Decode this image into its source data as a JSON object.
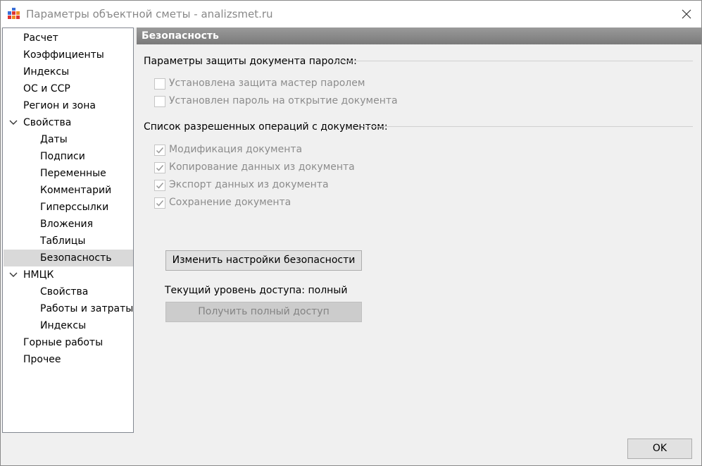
{
  "window": {
    "title": "Параметры объектной сметы - analizsmet.ru",
    "icon": "app-grid-icon",
    "close_icon": "close-icon"
  },
  "tree": {
    "items": [
      {
        "label": "Расчет",
        "level": 0
      },
      {
        "label": "Коэффициенты",
        "level": 0
      },
      {
        "label": "Индексы",
        "level": 0
      },
      {
        "label": "ОС и ССР",
        "level": 0
      },
      {
        "label": "Регион и зона",
        "level": 0
      },
      {
        "label": "Свойства",
        "level": 0,
        "expanded": true
      },
      {
        "label": "Даты",
        "level": 1
      },
      {
        "label": "Подписи",
        "level": 1
      },
      {
        "label": "Переменные",
        "level": 1
      },
      {
        "label": "Комментарий",
        "level": 1
      },
      {
        "label": "Гиперссылки",
        "level": 1
      },
      {
        "label": "Вложения",
        "level": 1
      },
      {
        "label": "Таблицы",
        "level": 1
      },
      {
        "label": "Безопасность",
        "level": 1,
        "selected": true
      },
      {
        "label": "НМЦК",
        "level": 0,
        "expanded": true
      },
      {
        "label": "Свойства",
        "level": 1
      },
      {
        "label": "Работы и затраты",
        "level": 1
      },
      {
        "label": "Индексы",
        "level": 1
      },
      {
        "label": "Горные работы",
        "level": 0
      },
      {
        "label": "Прочее",
        "level": 0
      }
    ]
  },
  "panel": {
    "header": "Безопасность",
    "password_group": {
      "title": "Параметры защиты документа паролем:",
      "options": [
        {
          "label": "Установлена защита мастер паролем",
          "checked": false
        },
        {
          "label": "Установлен пароль на открытие документа",
          "checked": false
        }
      ]
    },
    "operations_group": {
      "title": "Список разрешенных операций с документом:",
      "options": [
        {
          "label": "Модификация документа",
          "checked": true
        },
        {
          "label": "Копирование данных из документа",
          "checked": true
        },
        {
          "label": "Экспорт данных из документа",
          "checked": true
        },
        {
          "label": "Сохранение документа",
          "checked": true
        }
      ]
    },
    "change_button": "Изменить настройки безопасности",
    "access_level": "Текущий уровень доступа: полный",
    "full_access_button": "Получить полный доступ"
  },
  "footer": {
    "ok_label": "OK"
  },
  "colors": {
    "header_bg": "#8a8a8a",
    "selected_bg": "#d9d9d9",
    "disabled_text": "#8c8c8c"
  }
}
